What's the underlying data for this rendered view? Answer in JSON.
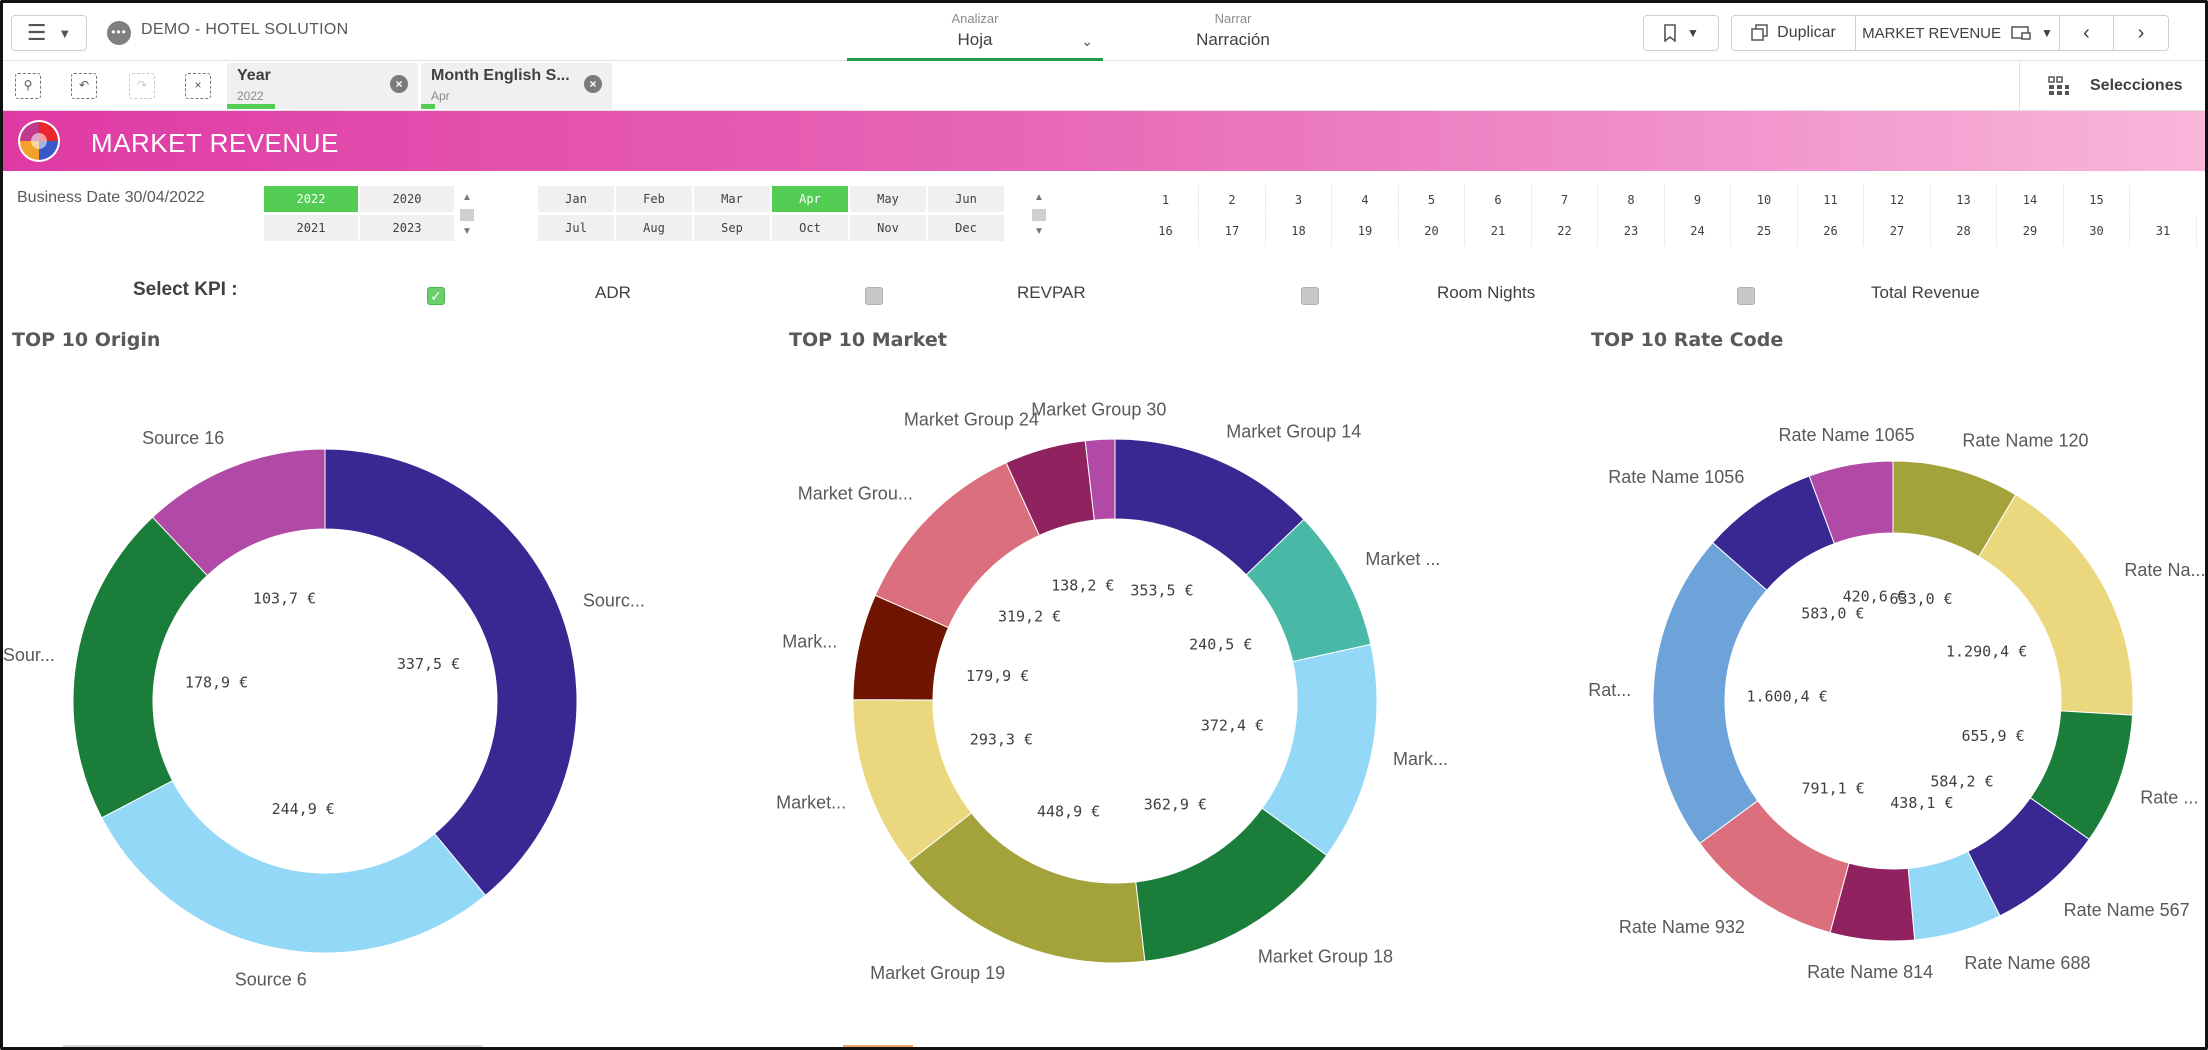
{
  "topbar": {
    "app_title": "DEMO - HOTEL SOLUTION",
    "analizar_label": "Analizar",
    "analizar_sheet": "Hoja",
    "narrar_label": "Narrar",
    "narrar_value": "Narración",
    "duplicate_label": "Duplicar",
    "current_sheet": "MARKET REVENUE"
  },
  "selections": {
    "chips": [
      {
        "name": "Year",
        "value": "2022"
      },
      {
        "name": "Month English S...",
        "value": "Apr"
      }
    ],
    "selections_label": "Selecciones"
  },
  "banner": {
    "title": "MARKET REVENUE"
  },
  "filters": {
    "business_date": "Business Date 30/04/2022",
    "years": [
      "2022",
      "2020",
      "2021",
      "2023"
    ],
    "selected_year": "2022",
    "months": [
      "Jan",
      "Feb",
      "Mar",
      "Apr",
      "May",
      "Jun",
      "Jul",
      "Aug",
      "Sep",
      "Oct",
      "Nov",
      "Dec"
    ],
    "selected_month": "Apr",
    "days": [
      "1",
      "2",
      "3",
      "4",
      "5",
      "6",
      "7",
      "8",
      "9",
      "10",
      "11",
      "12",
      "13",
      "14",
      "15",
      "16",
      "17",
      "18",
      "19",
      "20",
      "21",
      "22",
      "23",
      "24",
      "25",
      "26",
      "27",
      "28",
      "29",
      "30",
      "31"
    ]
  },
  "kpi": {
    "label": "Select KPI :",
    "options": [
      {
        "name": "ADR",
        "checked": true
      },
      {
        "name": "REVPAR",
        "checked": false
      },
      {
        "name": "Room Nights",
        "checked": false
      },
      {
        "name": "Total Revenue",
        "checked": false
      }
    ]
  },
  "chart_data": [
    {
      "type": "pie",
      "title": "TOP 10 Origin",
      "slices": [
        {
          "label": "Sourc...",
          "value_label": "337,5 €",
          "value": 337.5,
          "color": "#3a2892"
        },
        {
          "label": "Source 6",
          "value_label": "244,9 €",
          "value": 244.9,
          "color": "#94d8f8"
        },
        {
          "label": "Sour...",
          "value_label": "178,9 €",
          "value": 178.9,
          "color": "#1b7d3a"
        },
        {
          "label": "Source 16",
          "value_label": "103,7 €",
          "value": 103.7,
          "color": "#b14aa6"
        }
      ]
    },
    {
      "type": "pie",
      "title": "TOP 10 Market",
      "slices": [
        {
          "label": "Market Group 14",
          "value_label": "353,5 €",
          "value": 353.5,
          "color": "#3a2892"
        },
        {
          "label": "Market ...",
          "value_label": "240,5 €",
          "value": 240.5,
          "color": "#4ab8a6"
        },
        {
          "label": "Mark...",
          "value_label": "372,4 €",
          "value": 372.4,
          "color": "#94d8f8"
        },
        {
          "label": "Market Group 18",
          "value_label": "362,9 €",
          "value": 362.9,
          "color": "#1b7d3a"
        },
        {
          "label": "Market Group 19",
          "value_label": "448,9 €",
          "value": 448.9,
          "color": "#a4a23a"
        },
        {
          "label": "Market...",
          "value_label": "293,3 €",
          "value": 293.3,
          "color": "#ead77e"
        },
        {
          "label": "Mark...",
          "value_label": "179,9 €",
          "value": 179.9,
          "color": "#6e1400"
        },
        {
          "label": "Market Grou...",
          "value_label": "319,2 €",
          "value": 319.2,
          "color": "#dc6f7e"
        },
        {
          "label": "Market Group 24",
          "value_label": "138,2 €",
          "value": 138.2,
          "color": "#902260"
        },
        {
          "label": "Market Group 30",
          "value_label": "",
          "value": 50,
          "color": "#b14aa6"
        }
      ]
    },
    {
      "type": "pie",
      "title": "TOP 10 Rate Code",
      "slices": [
        {
          "label": "Rate Name 120",
          "value_label": "633,0 €",
          "value": 633.0,
          "color": "#a4a23a"
        },
        {
          "label": "Rate Na...",
          "value_label": "1.290,4 €",
          "value": 1290.4,
          "color": "#ead77e"
        },
        {
          "label": "Rate ...",
          "value_label": "655,9 €",
          "value": 655.9,
          "color": "#1b7d3a"
        },
        {
          "label": "Rate Name 567",
          "value_label": "584,2 €",
          "value": 584.2,
          "color": "#3a2892"
        },
        {
          "label": "Rate Name 688",
          "value_label": "438,1 €",
          "value": 438.1,
          "color": "#94d8f8"
        },
        {
          "label": "Rate Name 814",
          "value_label": "",
          "value": 420,
          "color": "#902260"
        },
        {
          "label": "Rate Name 932",
          "value_label": "791,1 €",
          "value": 791.1,
          "color": "#dc6f7e"
        },
        {
          "label": "Rat...",
          "value_label": "1.600,4 €",
          "value": 1600.4,
          "color": "#6da3d8"
        },
        {
          "label": "Rate Name 1056",
          "value_label": "583,0 €",
          "value": 583.0,
          "color": "#3a2892"
        },
        {
          "label": "Rate Name 1065",
          "value_label": "420,6 €",
          "value": 420.6,
          "color": "#b14aa6"
        }
      ]
    }
  ]
}
